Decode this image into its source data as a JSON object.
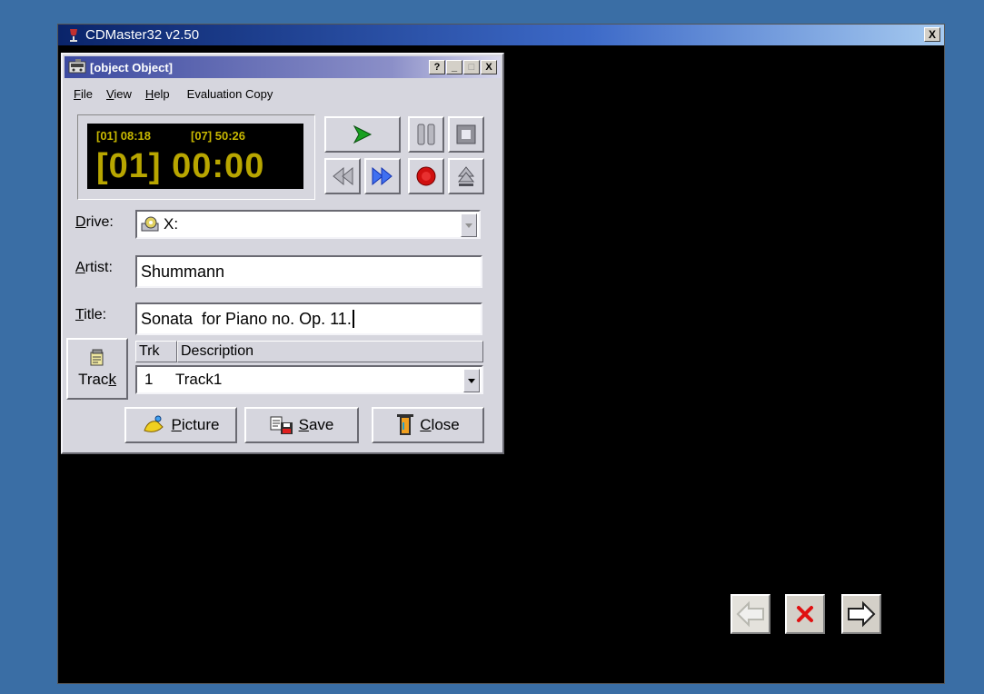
{
  "window": {
    "title": "CDMaster32 v2.50",
    "close_glyph": "X"
  },
  "dialog": {
    "title": {
      "label_u": "T",
      "label_rest": "itle:",
      "value": "Sonata  for Piano no. Op. 11."
    },
    "title_buttons": [
      "?",
      "_",
      "□",
      "X"
    ],
    "menu": [
      {
        "label": "File",
        "underline": "F",
        "rest": "ile"
      },
      {
        "label": "View",
        "underline": "V",
        "rest": "iew"
      },
      {
        "label": "Help",
        "underline": "H",
        "rest": "elp"
      },
      {
        "label": "Evaluation Copy"
      }
    ],
    "display": {
      "track_time": "[01] 08:18",
      "total_time": "[07] 50:26",
      "current": "[01] 00:00"
    },
    "drive": {
      "label_u": "D",
      "label_rest": "rive:",
      "value": "X:"
    },
    "artist": {
      "label_u": "A",
      "label_rest": "rtist:",
      "value": "Shummann"
    },
    "track_button": {
      "label_main": "Trac",
      "label_u": "k"
    },
    "track_table": {
      "columns": [
        "Trk",
        "Description"
      ],
      "row": {
        "trk": "1",
        "description": "Track1"
      }
    },
    "buttons": {
      "picture": {
        "u": "P",
        "rest": "icture"
      },
      "save": {
        "u": "S",
        "rest": "ave"
      },
      "close": {
        "u": "C",
        "rest": "lose"
      }
    }
  },
  "colors": {
    "accent_green": "#18a020",
    "blue_arrows": "#2040e0",
    "record_red": "#d01010",
    "lcd_yellow": "#c8b800"
  },
  "icons": [
    "play-icon",
    "pause-icon",
    "stop-icon",
    "rewind-icon",
    "fast-forward-icon",
    "record-icon",
    "eject-icon",
    "cd-drive-icon",
    "notes-icon",
    "picture-icon",
    "save-icon",
    "close-door-icon",
    "nav-back-icon",
    "cancel-icon",
    "nav-forward-icon"
  ]
}
